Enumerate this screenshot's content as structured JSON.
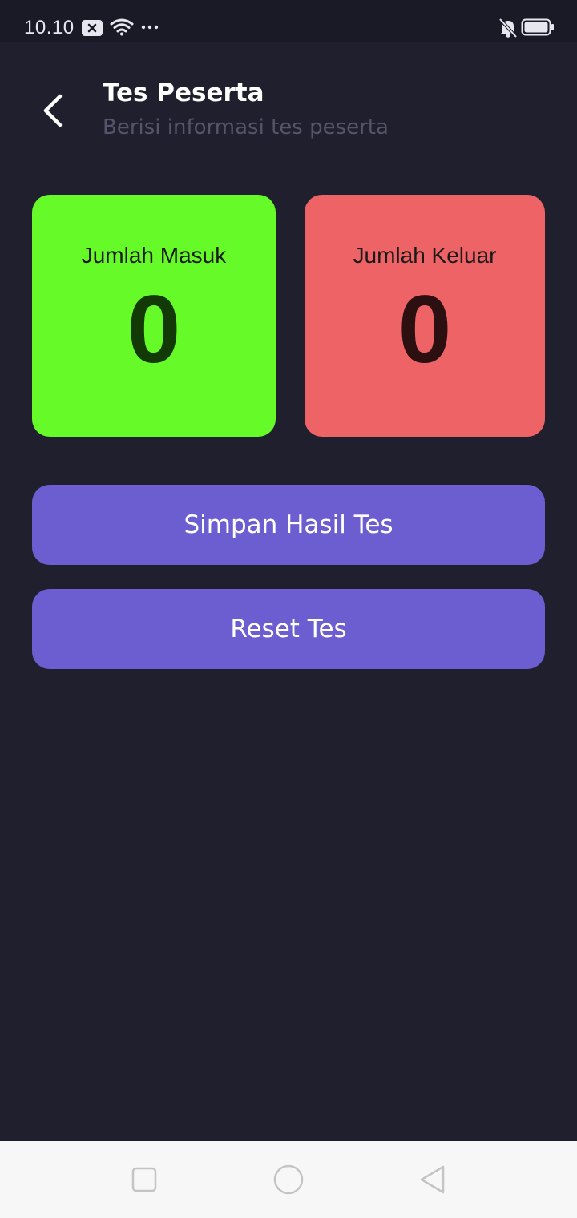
{
  "status_bar": {
    "time": "10.10",
    "icons": [
      "notification-icon",
      "wifi-icon",
      "more-dots-icon",
      "silent-bell-icon",
      "battery-icon"
    ]
  },
  "header": {
    "back_icon": "back-arrow-icon",
    "title": "Tes Peserta",
    "subtitle": "Berisi informasi tes peserta"
  },
  "stats": {
    "masuk": {
      "label": "Jumlah Masuk",
      "value": "0",
      "color": "#65fa28"
    },
    "keluar": {
      "label": "Jumlah Keluar",
      "value": "0",
      "color": "#ee6466"
    }
  },
  "actions": {
    "save_label": "Simpan Hasil Tes",
    "reset_label": "Reset Tes",
    "color": "#6c5dd0"
  },
  "nav_bar": {
    "icons": [
      "recents-square-icon",
      "home-circle-icon",
      "back-triangle-icon"
    ]
  },
  "theme": {
    "background": "#201f2d",
    "status_bar": "#1a1926"
  }
}
